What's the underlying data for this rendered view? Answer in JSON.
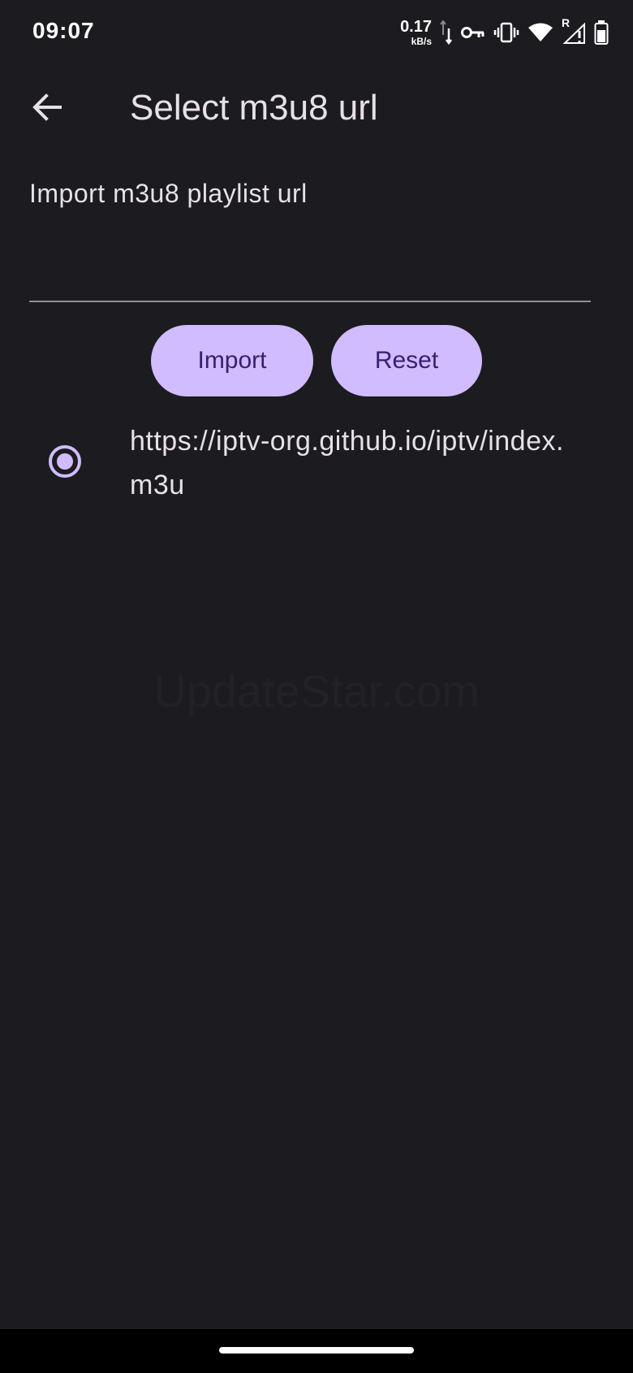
{
  "status_bar": {
    "time": "09:07",
    "net_speed_value": "0.17",
    "net_speed_unit": "kB/s",
    "icons": [
      "data-transfer-icon",
      "vpn-key-icon",
      "vibrate-icon",
      "wifi-icon",
      "signal-roaming-icon",
      "battery-icon"
    ],
    "roaming_label": "R"
  },
  "app_bar": {
    "title": "Select m3u8 url",
    "back_icon": "arrow-back-icon"
  },
  "form": {
    "label": "Import m3u8 playlist url",
    "input_value": "",
    "import_label": "Import",
    "reset_label": "Reset"
  },
  "url_list": {
    "items": [
      {
        "url": "https://iptv-org.github.io/iptv/index.m3u",
        "selected": true
      }
    ]
  },
  "watermark": "UpdateStar.com",
  "colors": {
    "background": "#1c1b1f",
    "primary": "#d0bcff",
    "on_primary": "#381e72",
    "text": "#e6e1e5",
    "outline": "#938f99"
  }
}
